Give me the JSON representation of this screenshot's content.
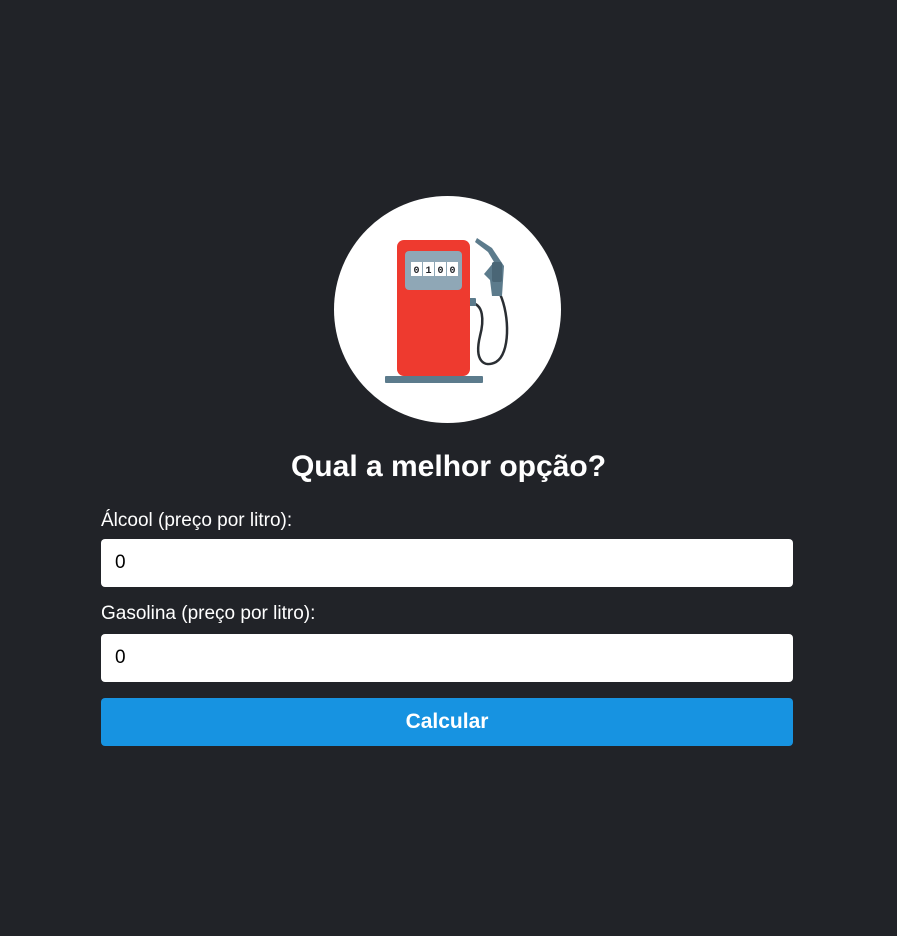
{
  "header": {
    "title": "Qual a melhor opção?"
  },
  "logo": {
    "icon": "fuel-pump-icon",
    "meter_digits": [
      "0",
      "1",
      "0",
      "0"
    ],
    "colors": {
      "pump_body": "#EE3A2F",
      "meter_panel": "#8FA7B6",
      "hose": "#2A2E33",
      "nozzle": "#5C7B8C",
      "base": "#5C7B8C"
    }
  },
  "form": {
    "alcool": {
      "label": "Álcool (preço por litro):",
      "value": "0"
    },
    "gasolina": {
      "label": "Gasolina (preço por litro):",
      "value": "0"
    },
    "submit_label": "Calcular"
  },
  "theme": {
    "background": "#212328",
    "button": "#1793E1"
  }
}
